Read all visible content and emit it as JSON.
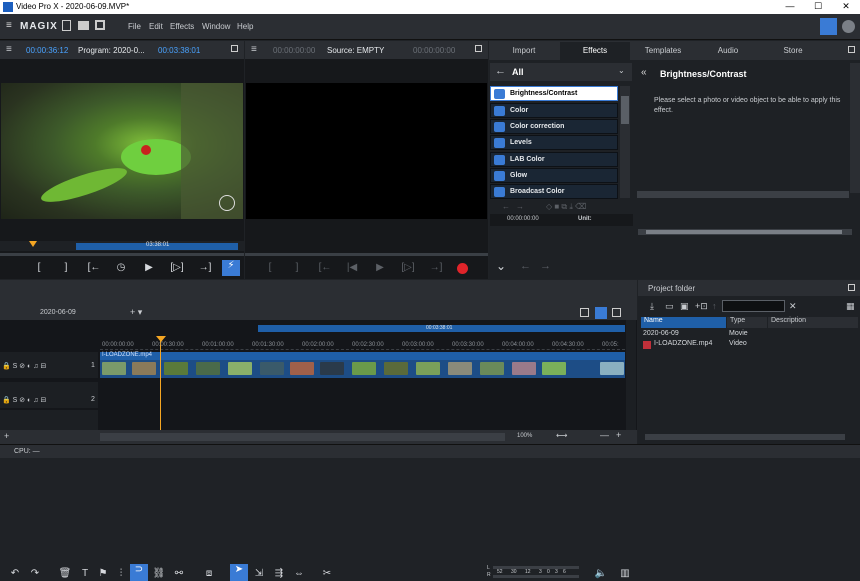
{
  "window": {
    "title": "Video Pro X - 2020-06-09.MVP*",
    "min": "—",
    "max": "☐",
    "close": "✕"
  },
  "menu": {
    "brand": "MAGIX",
    "items": [
      "File",
      "Edit",
      "Effects",
      "Window",
      "Help"
    ]
  },
  "program_monitor": {
    "timecode": "00:00:36:12",
    "label": "Program: 2020-0...",
    "duration": "00:03:38:01",
    "scrub_label": "03:38:01"
  },
  "source_monitor": {
    "timecode": "00:00:00:00",
    "label": "Source: EMPTY",
    "duration": "00:00:00:00"
  },
  "media_pool": {
    "tabs": [
      "Import",
      "Effects",
      "Templates",
      "Audio",
      "Store"
    ],
    "active_tab": "Effects",
    "breadcrumb": "All",
    "effects": [
      "Brightness/Contrast",
      "Color",
      "Color correction",
      "Levels",
      "LAB Color",
      "Glow",
      "Broadcast Color"
    ],
    "selected_effect": "Brightness/Contrast",
    "detail_title": "Brightness/Contrast",
    "detail_text": "Please select a photo or video object to be able to apply this effect.",
    "kf_time": "00:00:00:00",
    "kf_unit": "Unit:"
  },
  "timeline": {
    "tab_name": "2020-06-09",
    "duration_label": "00:03:38:01",
    "ruler": [
      "00:00:00:00",
      "00:00:30:00",
      "00:01:00:00",
      "00:01:30:00",
      "00:02:00:00",
      "00:02:30:00",
      "00:03:00:00",
      "00:03:30:00",
      "00:04:00:00",
      "00:04:30:00",
      "00:05:"
    ],
    "clip_name": "I-LOADZONE.mp4",
    "track_numbers": [
      "1",
      "2"
    ],
    "zoom": "100%",
    "meter_labels": [
      "L",
      "R",
      "52",
      "30",
      "12",
      "3",
      "0",
      "3",
      "6"
    ]
  },
  "project_folder": {
    "title": "Project folder",
    "columns": [
      "Name",
      "Type",
      "Description"
    ],
    "rows": [
      {
        "name": "2020-06-09",
        "type": "Movie"
      },
      {
        "name": "I-LOADZONE.mp4",
        "type": "Video"
      }
    ]
  },
  "status": {
    "cpu": "CPU: —"
  },
  "colors": {
    "accent": "#3a7bd5",
    "timecode": "#4aa3ff",
    "record": "#e0242a",
    "playhead": "#f5a623"
  }
}
